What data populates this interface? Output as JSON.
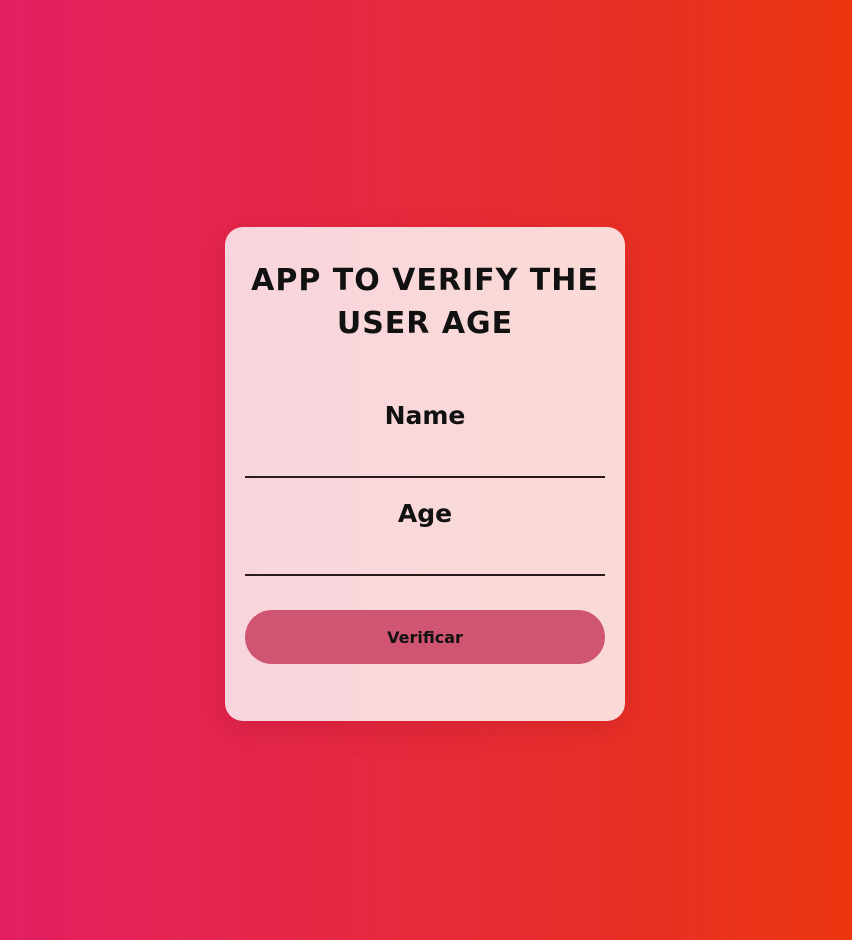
{
  "form": {
    "title": "APP TO VERIFY THE USER AGE",
    "name_label": "Name",
    "name_value": "",
    "age_label": "Age",
    "age_value": "",
    "submit_label": "Verificar"
  },
  "colors": {
    "background_start": "#e31f62",
    "background_end": "#eb360f",
    "card": "#f9d8da",
    "button": "#cf5573"
  }
}
